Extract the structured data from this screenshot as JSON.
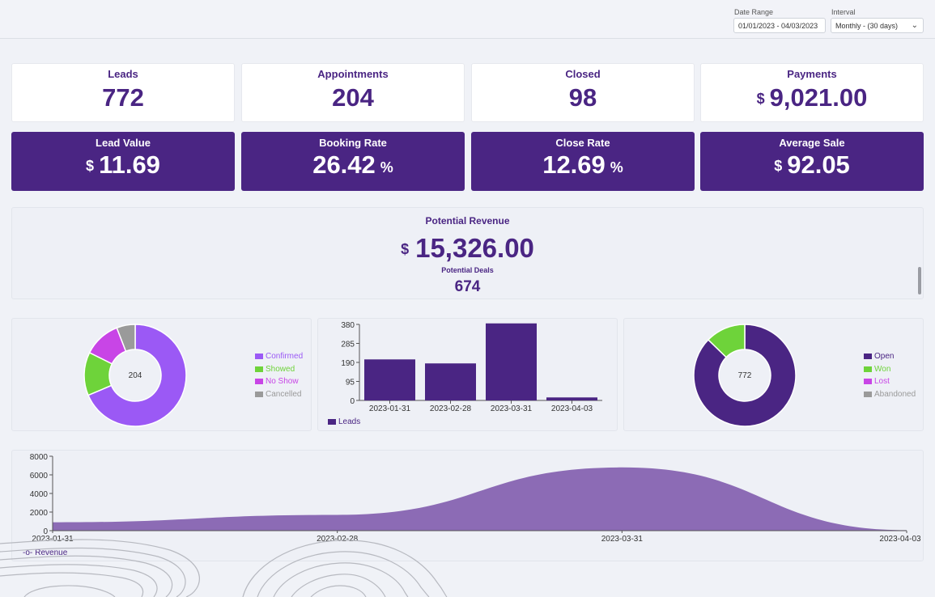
{
  "filters": {
    "date_range_label": "Date Range",
    "date_range_value": "01/01/2023 - 04/03/2023",
    "interval_label": "Interval",
    "interval_value": "Monthly - (30 days)"
  },
  "metrics": [
    {
      "label": "Leads",
      "value": "772"
    },
    {
      "label": "Appointments",
      "value": "204"
    },
    {
      "label": "Closed",
      "value": "98"
    },
    {
      "label": "Payments",
      "currency": "$",
      "value": "9,021.00"
    }
  ],
  "rates": [
    {
      "label": "Lead Value",
      "currency": "$",
      "value": "11.69"
    },
    {
      "label": "Booking Rate",
      "value": "26.42",
      "suffix": "%"
    },
    {
      "label": "Close Rate",
      "value": "12.69",
      "suffix": "%"
    },
    {
      "label": "Average Sale",
      "currency": "$",
      "value": "92.05"
    }
  ],
  "potential": {
    "title": "Potential Revenue",
    "currency": "$",
    "value": "15,326.00",
    "deals_title": "Potential Deals",
    "deals_value": "674"
  },
  "colors": {
    "brand": "#4a2583",
    "confirmed": "#9b59f5",
    "showed": "#6ed33a",
    "no_show": "#c845e6",
    "cancelled": "#9a9a9a",
    "open": "#4a2583",
    "won": "#6ed33a",
    "lost": "#c845e6",
    "abandoned": "#9a9a9a",
    "revenue_fill": "#8c6bb5"
  },
  "chart_data": [
    {
      "type": "pie",
      "center_label": "204",
      "legend_position": "right",
      "slices": [
        {
          "name": "Confirmed",
          "value": 140
        },
        {
          "name": "Showed",
          "value": 28
        },
        {
          "name": "No Show",
          "value": 24
        },
        {
          "name": "Cancelled",
          "value": 12
        }
      ]
    },
    {
      "type": "bar",
      "categories": [
        "2023-01-31",
        "2023-02-28",
        "2023-03-31",
        "2023-04-03"
      ],
      "series": [
        {
          "name": "Leads",
          "values": [
            205,
            185,
            385,
            15
          ]
        }
      ],
      "ylim": [
        0,
        380
      ],
      "yticks": [
        "0",
        "95",
        "190",
        "285",
        "380"
      ],
      "legend_position": "bottom-left"
    },
    {
      "type": "pie",
      "center_label": "772",
      "legend_position": "right",
      "slices": [
        {
          "name": "Open",
          "value": 674
        },
        {
          "name": "Won",
          "value": 98
        },
        {
          "name": "Lost",
          "value": 0
        },
        {
          "name": "Abandoned",
          "value": 0
        }
      ]
    },
    {
      "type": "area",
      "x": [
        "2023-01-31",
        "2023-02-28",
        "2023-03-31",
        "2023-04-03"
      ],
      "series": [
        {
          "name": "Revenue",
          "values": [
            900,
            1700,
            6800,
            50
          ]
        }
      ],
      "ylim": [
        0,
        8000
      ],
      "yticks": [
        "0",
        "2000",
        "4000",
        "6000",
        "8000"
      ],
      "legend_position": "bottom-left"
    }
  ]
}
